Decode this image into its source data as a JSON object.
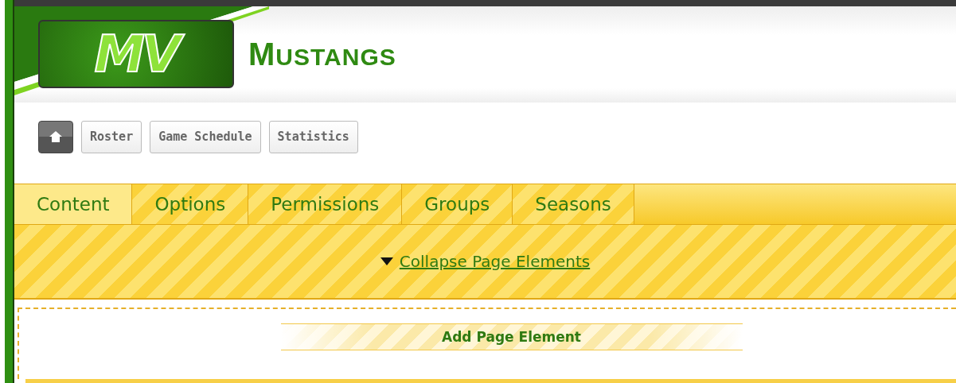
{
  "header": {
    "logo_text": "MV",
    "title": "MUSTANGS"
  },
  "nav": {
    "home": {
      "kind": "home"
    },
    "links": [
      "Roster",
      "Game Schedule",
      "Statistics"
    ]
  },
  "tabs": [
    {
      "label": "Content",
      "selected": true
    },
    {
      "label": "Options",
      "selected": false
    },
    {
      "label": "Permissions",
      "selected": false
    },
    {
      "label": "Groups",
      "selected": false
    },
    {
      "label": "Seasons",
      "selected": false
    }
  ],
  "toolbar": {
    "collapse_link": "Collapse Page Elements",
    "expanded": true
  },
  "editor": {
    "add_button": "Add Page Element"
  }
}
